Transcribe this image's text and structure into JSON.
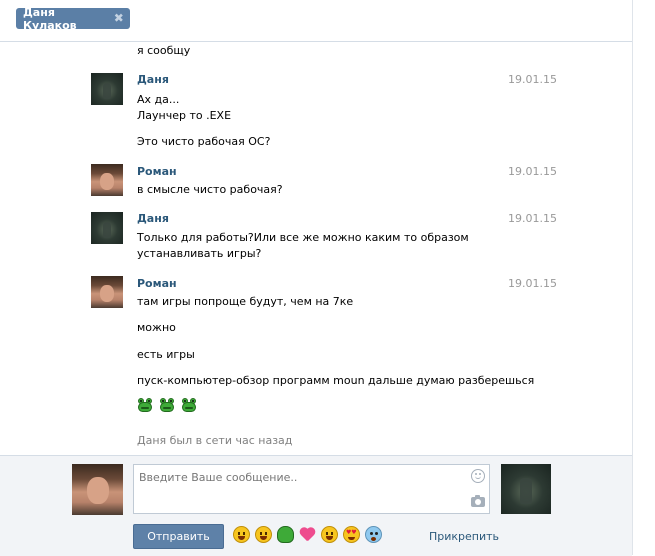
{
  "tab": {
    "title": "Даня Кулаков",
    "close_icon": "close-icon"
  },
  "history": {
    "top_fragment": "я сообщу",
    "messages": [
      {
        "author": "Даня",
        "date": "19.01.15",
        "lines": [
          "Ах да...",
          "Лаунчер то .EXE",
          "Это чисто рабочая ОС?"
        ]
      },
      {
        "author": "Роман",
        "date": "19.01.15",
        "lines": [
          "в смысле чисто рабочая?"
        ]
      },
      {
        "author": "Даня",
        "date": "19.01.15",
        "lines": [
          "Только для работы?Или все же можно каким то образом",
          "устанавливать игры?"
        ]
      },
      {
        "author": "Роман",
        "date": "19.01.15",
        "lines": [
          "там игры попроще будут, чем на 7ке",
          "можно",
          "есть игры",
          "пуск-компьютер-обзор программ moun дальше думаю разберешься"
        ]
      }
    ],
    "emoji_row": [
      "frog-emoji",
      "frog-emoji",
      "frog-emoji"
    ],
    "status": "Даня был в сети час назад"
  },
  "composer": {
    "placeholder": "Введите Ваше сообщение..",
    "send_label": "Отправить",
    "attach_label": "Прикрепить",
    "emoji_bar": [
      "grinning-emoji",
      "tears-of-joy-emoji",
      "frog-emoji",
      "heart-emoji",
      "smile-emoji",
      "heart-eyes-emoji",
      "scared-emoji"
    ]
  }
}
